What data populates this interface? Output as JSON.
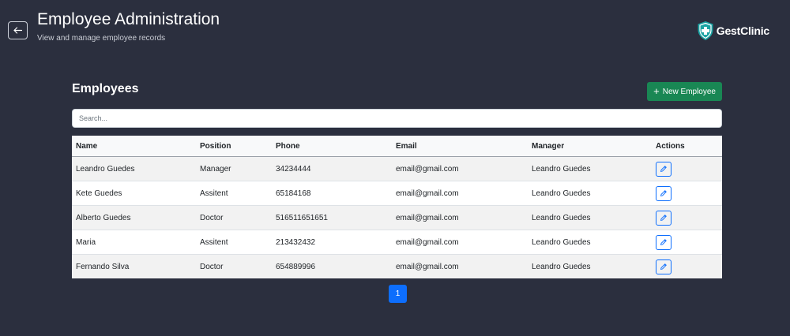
{
  "header": {
    "title": "Employee Administration",
    "subtitle": "View and manage employee records",
    "back_icon": "arrow-left-icon"
  },
  "brand": {
    "name": "GestClinic",
    "logo_icon": "shield-medical-cross-icon",
    "logo_color": "#1aa3a3"
  },
  "section": {
    "title": "Employees"
  },
  "toolbar": {
    "new_employee_label": "New Employee",
    "new_employee_color": "#198754"
  },
  "search": {
    "placeholder": "Search...",
    "value": ""
  },
  "table": {
    "columns": [
      "Name",
      "Position",
      "Phone",
      "Email",
      "Manager",
      "Actions"
    ],
    "rows": [
      [
        "Leandro Guedes",
        "Manager",
        "34234444",
        "email@gmail.com",
        "Leandro Guedes"
      ],
      [
        "Kete Guedes",
        "Assitent",
        "65184168",
        "email@gmail.com",
        "Leandro Guedes"
      ],
      [
        "Alberto Guedes",
        "Doctor",
        "516511651651",
        "email@gmail.com",
        "Leandro Guedes"
      ],
      [
        "Maria",
        "Assitent",
        "213432432",
        "email@gmail.com",
        "Leandro Guedes"
      ],
      [
        "Fernando Silva",
        "Doctor",
        "654889996",
        "email@gmail.com",
        "Leandro Guedes"
      ]
    ],
    "action_icon": "pencil-icon"
  },
  "pagination": {
    "current_page": "1",
    "active_color": "#0d6efd"
  }
}
